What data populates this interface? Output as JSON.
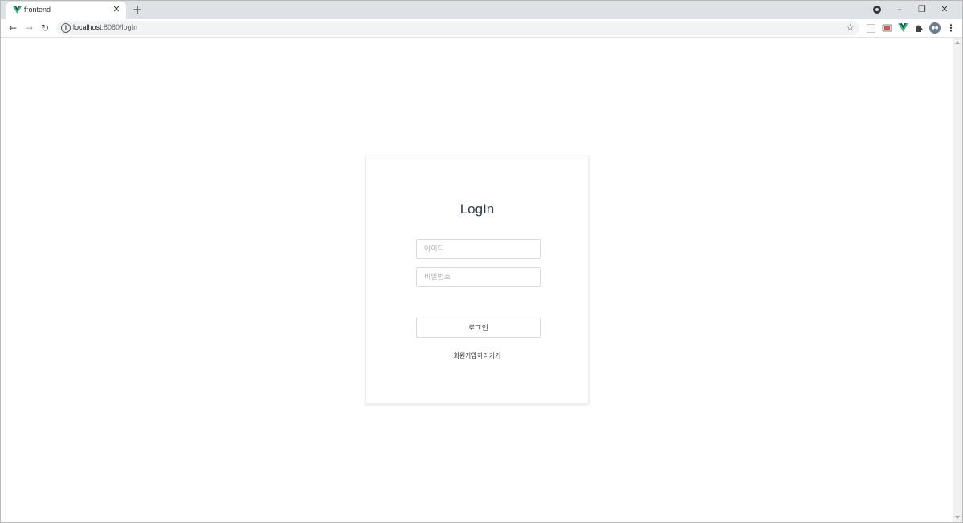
{
  "browser": {
    "tab": {
      "title": "frontend",
      "close_glyph": "✕",
      "favicon": "vue-logo-icon"
    },
    "new_tab_glyph": "+",
    "window_controls": {
      "minimize_glyph": "–",
      "restore_glyph": "❐",
      "close_glyph": "✕"
    },
    "nav": {
      "back_glyph": "←",
      "forward_glyph": "→",
      "reload_glyph": "↻"
    },
    "address": {
      "host": "localhost",
      "path": ":8080/logIn",
      "info_glyph": "i"
    },
    "bookmark_glyph": "☆",
    "menu_glyph": "⋮"
  },
  "login": {
    "title": "LogIn",
    "id_placeholder": "아이디",
    "password_placeholder": "비밀번호",
    "submit_label": "로그인",
    "signup_link": "회원가입하러가기"
  },
  "colors": {
    "accent_vue": "#41b883",
    "title_text": "#2c3e50",
    "tabstrip": "#dee1e6",
    "omnibox": "#f1f3f4"
  }
}
